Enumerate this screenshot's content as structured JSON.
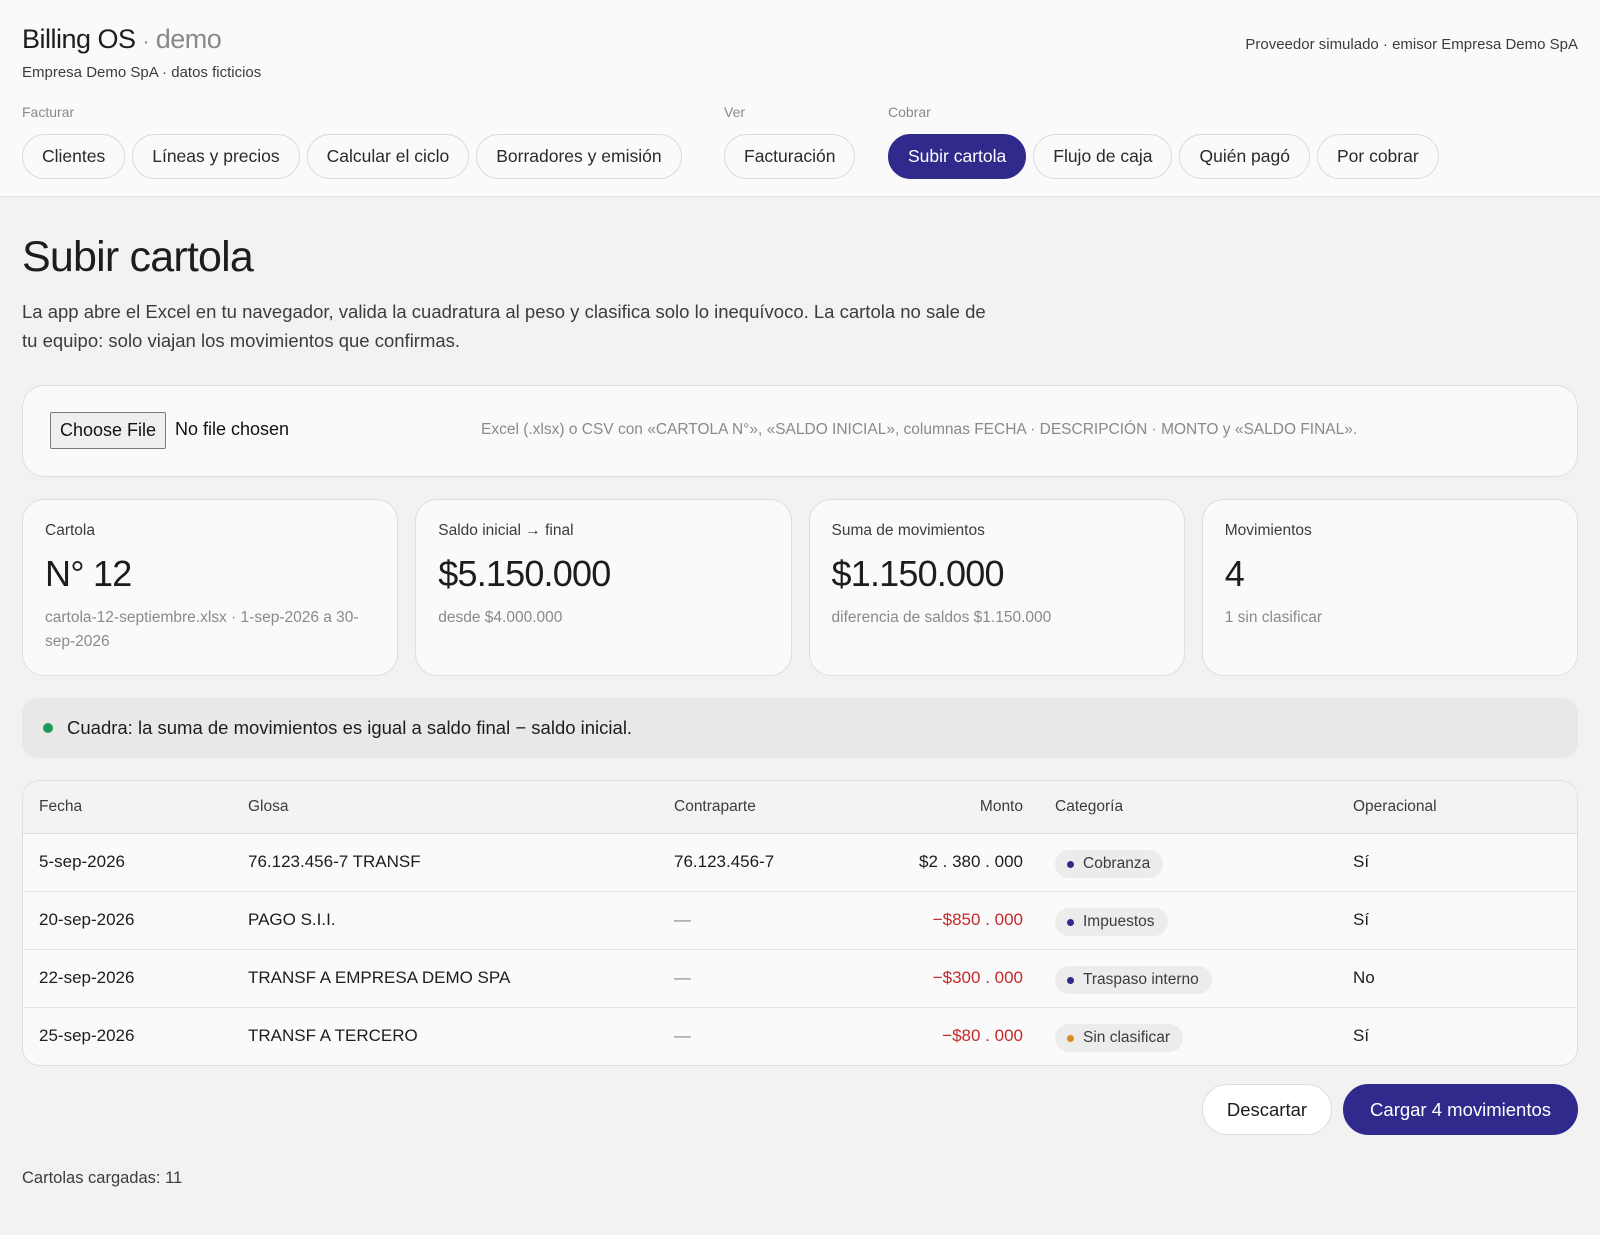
{
  "app": {
    "name": "Billing OS",
    "separator": "·",
    "env": "demo",
    "subtitle": "Empresa Demo SpA · datos ficticios",
    "provider": "Proveedor simulado · emisor Empresa Demo SpA"
  },
  "nav": {
    "groups": [
      {
        "label": "Facturar",
        "items": [
          "Clientes",
          "Líneas y precios",
          "Calcular el ciclo",
          "Borradores y emisión"
        ]
      },
      {
        "label": "Ver",
        "items": [
          "Facturación"
        ]
      },
      {
        "label": "Cobrar",
        "items": [
          "Subir cartola",
          "Flujo de caja",
          "Quién pagó",
          "Por cobrar"
        ]
      }
    ],
    "active": "Subir cartola"
  },
  "page": {
    "title": "Subir cartola",
    "intro": "La app abre el Excel en tu navegador, valida la cuadratura al peso y clasifica solo lo inequívoco. La cartola no sale de tu equipo: solo viajan los movimientos que confirmas."
  },
  "upload": {
    "button_label": "Choose File",
    "status": "No file chosen",
    "hint": "Excel (.xlsx) o CSV con «CARTOLA N°», «SALDO INICIAL», columnas FECHA · DESCRIPCIÓN · MONTO y «SALDO FINAL»."
  },
  "cards": [
    {
      "label": "Cartola",
      "value": "N° 12",
      "note": "cartola-12-septiembre.xlsx · 1-sep-2026 a 30-sep-2026"
    },
    {
      "label": "Saldo inicial → final",
      "value": "$5.150.000",
      "note": "desde $4.000.000"
    },
    {
      "label": "Suma de movimientos",
      "value": "$1.150.000",
      "note": "diferencia de saldos $1.150.000"
    },
    {
      "label": "Movimientos",
      "value": "4",
      "note": "1 sin clasificar"
    }
  ],
  "banner": {
    "text": "Cuadra: la suma de movimientos es igual a saldo final − saldo inicial.",
    "status_color": "#1a9a5a"
  },
  "table": {
    "headers": {
      "fecha": "Fecha",
      "glosa": "Glosa",
      "contraparte": "Contraparte",
      "monto": "Monto",
      "categoria": "Categoría",
      "operacional": "Operacional"
    },
    "rows": [
      {
        "fecha": "5-sep-2026",
        "glosa": "76.123.456-7 TRANSF",
        "contraparte": "76.123.456-7",
        "monto": "$2 . 380 . 000",
        "categoria": "Cobranza",
        "operacional": "Sí"
      },
      {
        "fecha": "20-sep-2026",
        "glosa": "PAGO S.I.I.",
        "contraparte": "—",
        "monto": "−$850 . 000",
        "categoria": "Impuestos",
        "operacional": "Sí"
      },
      {
        "fecha": "22-sep-2026",
        "glosa": "TRANSF A EMPRESA DEMO SPA",
        "contraparte": "—",
        "monto": "−$300 . 000",
        "categoria": "Traspaso interno",
        "operacional": "No"
      },
      {
        "fecha": "25-sep-2026",
        "glosa": "TRANSF A TERCERO",
        "contraparte": "—",
        "monto": "−$80 . 000",
        "categoria": "Sin clasificar",
        "operacional": "Sí"
      }
    ],
    "category_colors": {
      "classified": "#2f2a8c",
      "unclassified": "#e08a1e"
    },
    "negative_color": "#c42a2a"
  },
  "actions": {
    "discard": "Descartar",
    "submit": "Cargar 4 movimientos"
  },
  "footer": {
    "text": "Cartolas cargadas: 11"
  }
}
